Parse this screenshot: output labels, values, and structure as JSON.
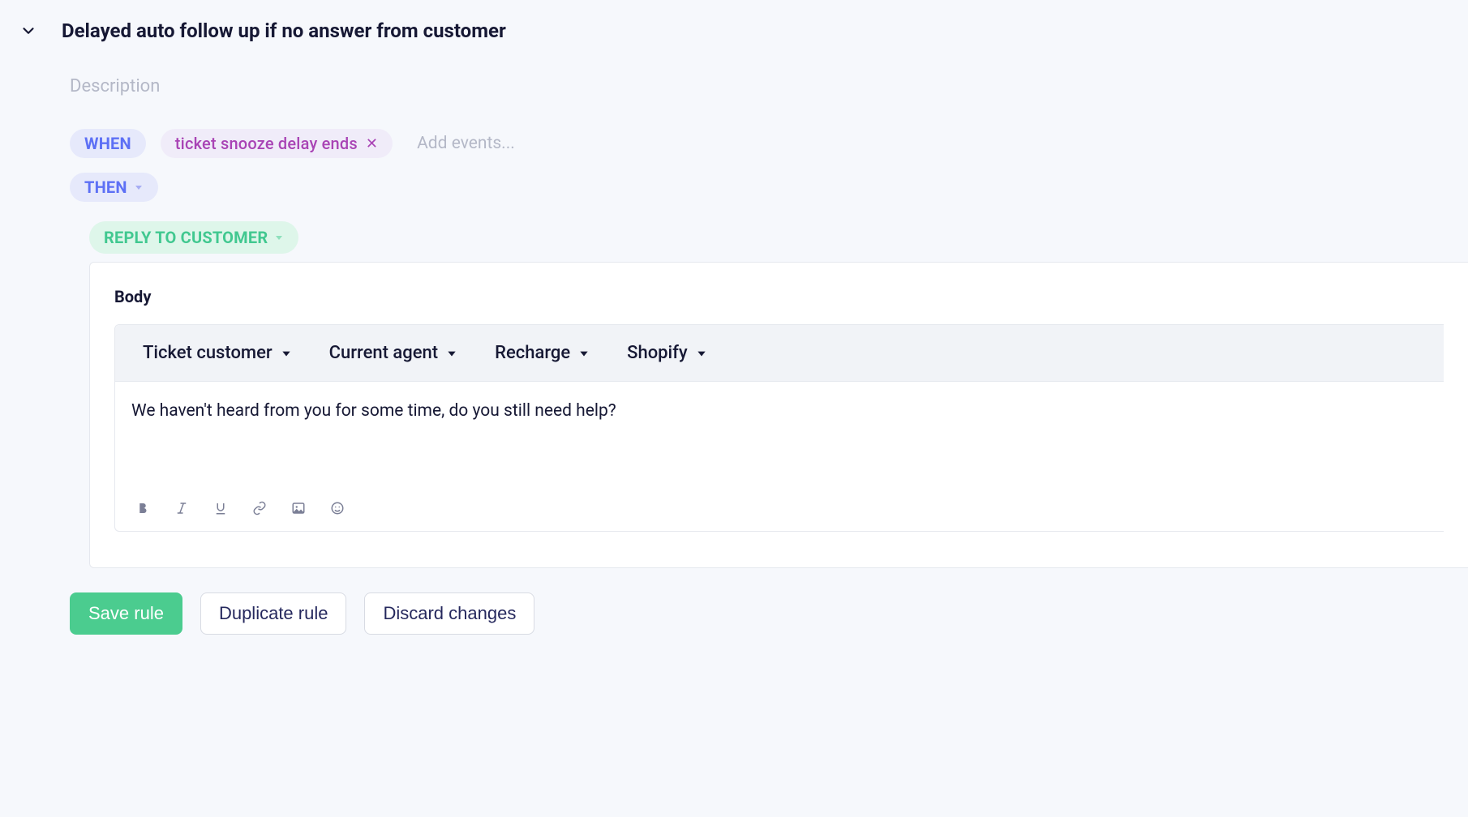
{
  "header": {
    "title": "Delayed auto follow up if no answer from customer",
    "description_placeholder": "Description"
  },
  "rule": {
    "when_label": "WHEN",
    "then_label": "THEN",
    "event_chip": "ticket snooze delay ends",
    "add_events_placeholder": "Add events...",
    "action_label": "REPLY TO CUSTOMER"
  },
  "editor": {
    "body_label": "Body",
    "toolbar_items": {
      "ticket_customer": "Ticket customer",
      "current_agent": "Current agent",
      "recharge": "Recharge",
      "shopify": "Shopify"
    },
    "body_text": "We haven't heard from you for some time, do you still need help?"
  },
  "buttons": {
    "save": "Save rule",
    "duplicate": "Duplicate rule",
    "discard": "Discard changes"
  }
}
